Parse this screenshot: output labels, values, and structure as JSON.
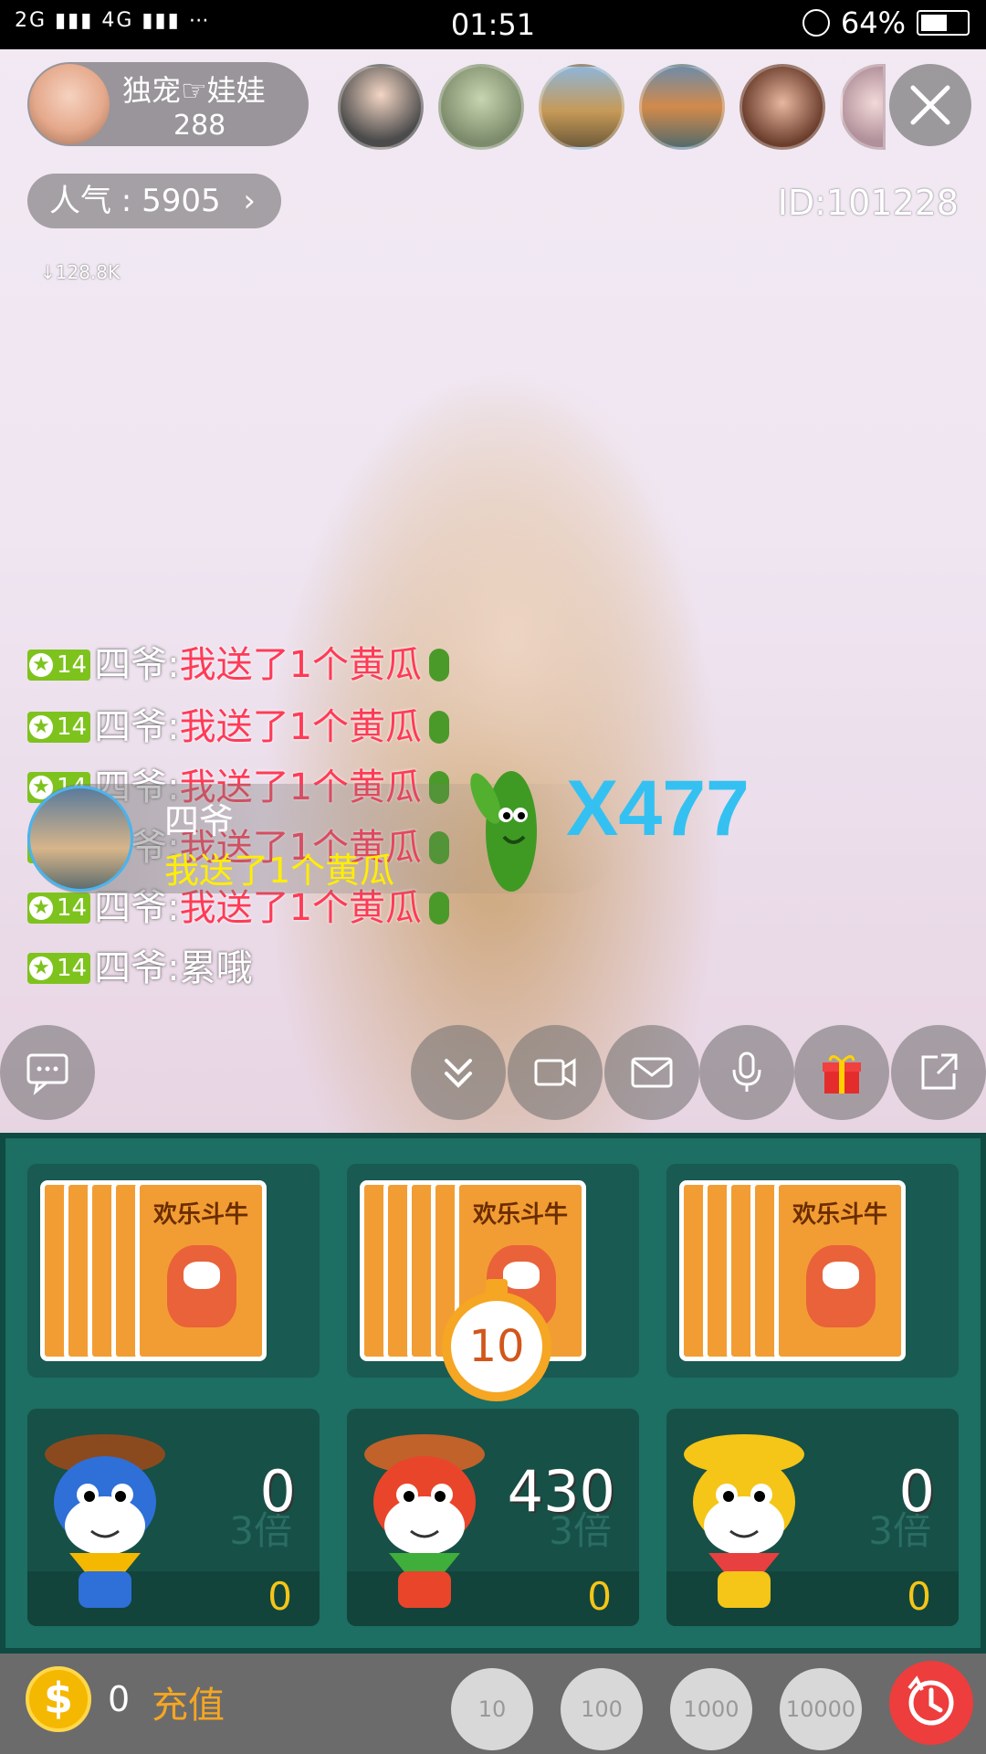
{
  "status_bar": {
    "signal": "2G ▮▮▮ 4G ▮▮▮ ⋯",
    "time": "01:51",
    "battery": "64%",
    "battery_level": 0.64
  },
  "host": {
    "name": "独宠☞娃娃",
    "count": "288"
  },
  "viewers": [
    "viewer-1",
    "viewer-2",
    "viewer-3",
    "viewer-4",
    "viewer-5",
    "viewer-6"
  ],
  "popularity": {
    "label": "人气 : 5905",
    "arrow": "›"
  },
  "room_id": "ID:101228",
  "net_speed": "↓128.8K",
  "chat": [
    {
      "level": "14",
      "user": "四爷:",
      "msg": "我送了1个黄瓜",
      "gift": true
    },
    {
      "level": "14",
      "user": "四爷:",
      "msg": "我送了1个黄瓜",
      "gift": true
    },
    {
      "level": "14",
      "user": "四爷:",
      "msg": "我送了1个黄瓜",
      "gift": true
    },
    {
      "level": "14",
      "user": "四爷:",
      "msg": "我送了1个黄瓜",
      "gift": true
    },
    {
      "level": "14",
      "user": "四爷:",
      "msg": "我送了1个黄瓜",
      "gift": true
    },
    {
      "level": "14",
      "user": "四爷:",
      "msg": "累哦",
      "gift": false
    }
  ],
  "gift_banner": {
    "user": "四爷",
    "text": "我送了1个黄瓜",
    "combo": "X477"
  },
  "controls": [
    "chat-icon",
    "collapse-icon",
    "camera-icon",
    "mail-icon",
    "mic-icon",
    "gift-icon",
    "share-icon"
  ],
  "game": {
    "card_title": "欢乐斗牛",
    "timer": "10",
    "seats": [
      {
        "total": "0",
        "mult": "3倍",
        "mine": "0",
        "mascot": "blue-cowboy"
      },
      {
        "total": "430",
        "mult": "3倍",
        "mine": "0",
        "mascot": "red-cowboy"
      },
      {
        "total": "0",
        "mult": "3倍",
        "mine": "0",
        "mascot": "yellow-bull"
      }
    ]
  },
  "bottom": {
    "coin_symbol": "$",
    "coins": "0",
    "recharge": "充值",
    "chips": [
      "10",
      "100",
      "1000",
      "10000"
    ]
  },
  "colors": {
    "accent_green": "#7ec31d",
    "combo_blue": "#34c1f2",
    "game_bg": "#1d6e63",
    "recharge_orange": "#f5a623"
  }
}
